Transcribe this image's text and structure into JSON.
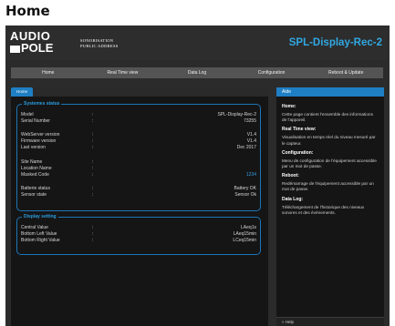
{
  "caption": "Home",
  "header": {
    "logo_top": "AUDIO",
    "logo_bottom": "POLE",
    "tagline_1": "SONORISATION",
    "tagline_2": "PUBLIC ADDRESS",
    "device_title": "SPL-Display-Rec-2"
  },
  "nav": [
    "Home",
    "Real Time view",
    "Data Log",
    "Configuration",
    "Reboot & Update"
  ],
  "main": {
    "tab": "Home",
    "system_status": {
      "legend": "Systemes status",
      "rows": [
        {
          "label": "Model",
          "colon": ":",
          "value": "SPL-Display-Rec-2"
        },
        {
          "label": "Serial Number",
          "colon": ":",
          "value": "73255"
        },
        {
          "label": "WebServer version",
          "colon": ":",
          "value": "V1.4"
        },
        {
          "label": "Firmware version",
          "colon": ":",
          "value": "V1.4"
        },
        {
          "label": "Last version",
          "colon": ":",
          "value": "Dec 2017"
        },
        {
          "label": "Site Name",
          "colon": ":",
          "value": ""
        },
        {
          "label": "Location Name",
          "colon": ":",
          "value": ""
        },
        {
          "label": "Masked Code",
          "colon": ":",
          "value": "1234"
        },
        {
          "label": "Batterie status",
          "colon": ":",
          "value": "Battery OK"
        },
        {
          "label": "Sensor state",
          "colon": ":",
          "value": "Sensor Ok"
        }
      ]
    },
    "display_setting": {
      "legend": "Display setting",
      "rows": [
        {
          "label": "Central Value",
          "colon": ":",
          "value": "LAeq1s"
        },
        {
          "label": "Bottom Left Value",
          "colon": ":",
          "value": "LAeq15min"
        },
        {
          "label": "Bottom Right Value",
          "colon": ":",
          "value": "LCeq15min"
        }
      ]
    }
  },
  "aside": {
    "title": "Aide",
    "sections": [
      {
        "heading": "Home:",
        "text": "Cette page contient l'ensemble des informations de l'appareil."
      },
      {
        "heading": "Real Time view:",
        "text": "Visualisation en temps réel du niveau mesuré par le capteur."
      },
      {
        "heading": "Configuration:",
        "text": "Menu de configuration de l'équipement accessible par un mot de passe."
      },
      {
        "heading": "Reboot:",
        "text": "Redémarrage de l'équipement accessible par un mot de passe."
      },
      {
        "heading": "Data Log:",
        "text": "Téléchargement de l'historique des niveaux sonores et des événements."
      }
    ],
    "help": "» Help"
  },
  "colors": {
    "accent": "#1f7fc4",
    "title": "#30a8e2",
    "link": "#3aa0e8"
  }
}
